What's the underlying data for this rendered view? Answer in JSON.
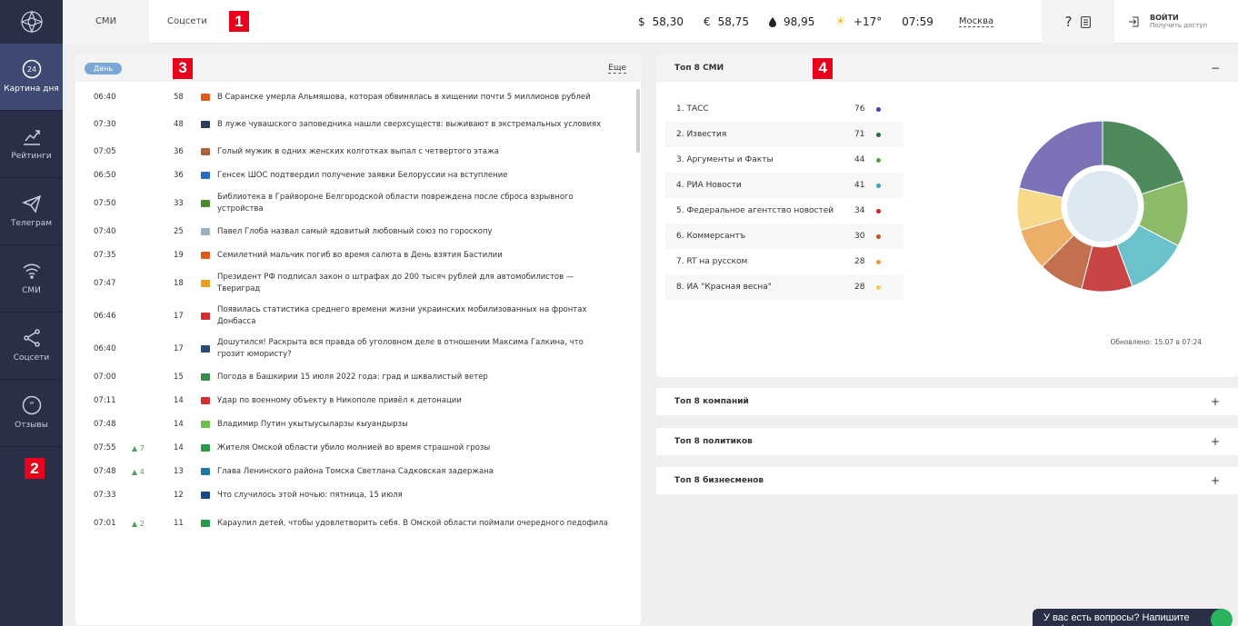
{
  "sidebar": {
    "items": [
      {
        "label": "Картина дня",
        "icon": "clock-24-icon",
        "active": true
      },
      {
        "label": "Рейтинги",
        "icon": "chart-icon",
        "active": false
      },
      {
        "label": "Телеграм",
        "icon": "telegram-icon",
        "active": false
      },
      {
        "label": "СМИ",
        "icon": "wifi-icon",
        "active": false
      },
      {
        "label": "Соцсети",
        "icon": "share-icon",
        "active": false
      },
      {
        "label": "Отзывы",
        "icon": "quote-icon",
        "active": false
      }
    ],
    "badge": "2"
  },
  "topbar": {
    "tabs": [
      "СМИ",
      "Соцсети"
    ],
    "badge": "1",
    "usd_symbol": "$",
    "usd": "58,30",
    "eur_symbol": "€",
    "eur": "58,75",
    "oil": "98,95",
    "temp": "+17°",
    "time": "07:59",
    "city": "Москва",
    "login_title": "ВОЙТИ",
    "login_sub": "Получить доступ"
  },
  "news": {
    "badge": "3",
    "period": "День",
    "more": "Еще",
    "rows": [
      {
        "time": "06:40",
        "trend": "",
        "count": "58",
        "color": "#e05a1c",
        "title": "В Саранске умерла Альмяшова, которая обвинялась в хищении почти 5 миллионов рублей"
      },
      {
        "time": "07:30",
        "trend": "",
        "count": "48",
        "color": "#2a3a5a",
        "title": "В луже чувашского заповедника нашли сверхсуществ: выживают в экстремальных условиях"
      },
      {
        "time": "07:05",
        "trend": "",
        "count": "36",
        "color": "#b0603a",
        "title": "Голый мужик в одних женских колготках выпал с четвертого этажа"
      },
      {
        "time": "06:50",
        "trend": "",
        "count": "36",
        "color": "#2a6ac0",
        "title": "Генсек ШОС подтвердил получение заявки Белоруссии на вступление"
      },
      {
        "time": "07:50",
        "trend": "",
        "count": "33",
        "color": "#4a8a2a",
        "title": "Библиотека в Грайвороне Белгородской области повреждена после сброса взрывного устройства"
      },
      {
        "time": "07:40",
        "trend": "",
        "count": "25",
        "color": "#9ab0c8",
        "title": "Павел Глоба назвал самый ядовитый любовный союз по гороскопу"
      },
      {
        "time": "07:35",
        "trend": "",
        "count": "19",
        "color": "#e05a1c",
        "title": "Семилетний мальчик погиб во время салюта в День взятия Бастилии"
      },
      {
        "time": "07:47",
        "trend": "",
        "count": "18",
        "color": "#e8a020",
        "title": "Президент РФ подписал закон о штрафах до 200 тысяч рублей для автомобилистов — Твериград"
      },
      {
        "time": "06:46",
        "trend": "",
        "count": "17",
        "color": "#d03030",
        "title": "Появилась статистика среднего времени жизни украинских мобилизованных на фронтах Донбасса"
      },
      {
        "time": "06:40",
        "trend": "",
        "count": "17",
        "color": "#2a4a7a",
        "title": "Дошутился! Раскрыта вся правда об уголовном деле в отношении Максима Галкина, что грозит юмористу?"
      },
      {
        "time": "07:00",
        "trend": "",
        "count": "15",
        "color": "#3a8a4a",
        "title": "Погода в Башкирии 15 июля 2022 года: град и шквалистый ветер"
      },
      {
        "time": "07:11",
        "trend": "",
        "count": "14",
        "color": "#d03030",
        "title": "Удар по военному объекту в Никополе привёл к детонации"
      },
      {
        "time": "07:48",
        "trend": "",
        "count": "14",
        "color": "#6ac04a",
        "title": "Владимир Путин укытыусыларзы кыуандырзы"
      },
      {
        "time": "07:55",
        "trend": "▲ 7",
        "count": "14",
        "color": "#2a9a4a",
        "title": "Жителя Омской области убило молнией во время страшной грозы"
      },
      {
        "time": "07:48",
        "trend": "▲ 4",
        "count": "13",
        "color": "#1a7aa0",
        "title": "Глава Ленинского района Томска Светлана Садковская задержана"
      },
      {
        "time": "07:33",
        "trend": "",
        "count": "12",
        "color": "#1a4a8a",
        "title": "Что случилось этой ночью: пятница, 15 июля"
      },
      {
        "time": "07:01",
        "trend": "▲ 2",
        "count": "11",
        "color": "#2a9a4a",
        "title": "Караулил детей, чтобы удовлетворить себя. В Омской области поймали очередного педофила"
      }
    ]
  },
  "top_smi": {
    "badge": "4",
    "title": "Топ 8 СМИ",
    "collapse": "−",
    "updated": "Обновлено: 15.07 в 07:24",
    "rows": [
      {
        "name": "1. ТАСС",
        "value": "76",
        "color": "#4a3fa8"
      },
      {
        "name": "2. Известия",
        "value": "71",
        "color": "#2e6b3d"
      },
      {
        "name": "3. Аргументы и Факты",
        "value": "44",
        "color": "#5c9e4a"
      },
      {
        "name": "4. РИА Новости",
        "value": "41",
        "color": "#3aa6b8"
      },
      {
        "name": "5. Федеральное агентство новостей",
        "value": "34",
        "color": "#c02a2a"
      },
      {
        "name": "6. Коммерсантъ",
        "value": "30",
        "color": "#b8532a"
      },
      {
        "name": "7. RT на русском",
        "value": "28",
        "color": "#e89a3a"
      },
      {
        "name": "8. ИА \"Красная весна\"",
        "value": "28",
        "color": "#f4c95a"
      }
    ]
  },
  "chart_data": {
    "type": "pie",
    "categories": [
      "ТАСС",
      "Известия",
      "Аргументы и Факты",
      "РИА Новости",
      "Федеральное агентство новостей",
      "Коммерсантъ",
      "RT на русском",
      "ИА \"Красная весна\""
    ],
    "values": [
      76,
      71,
      44,
      41,
      34,
      30,
      28,
      28
    ],
    "colors": [
      "#7b72b8",
      "#4e8a5e",
      "#8dbb6a",
      "#6cc2cc",
      "#c94444",
      "#c27050",
      "#edae68",
      "#f7d98c"
    ]
  },
  "accordions": [
    {
      "title": "Топ 8 компаний",
      "sign": "+"
    },
    {
      "title": "Топ 8 политиков",
      "sign": "+"
    },
    {
      "title": "Топ 8 бизнесменов",
      "sign": "+"
    }
  ],
  "chat": "У вас есть вопросы? Напишите нам!"
}
